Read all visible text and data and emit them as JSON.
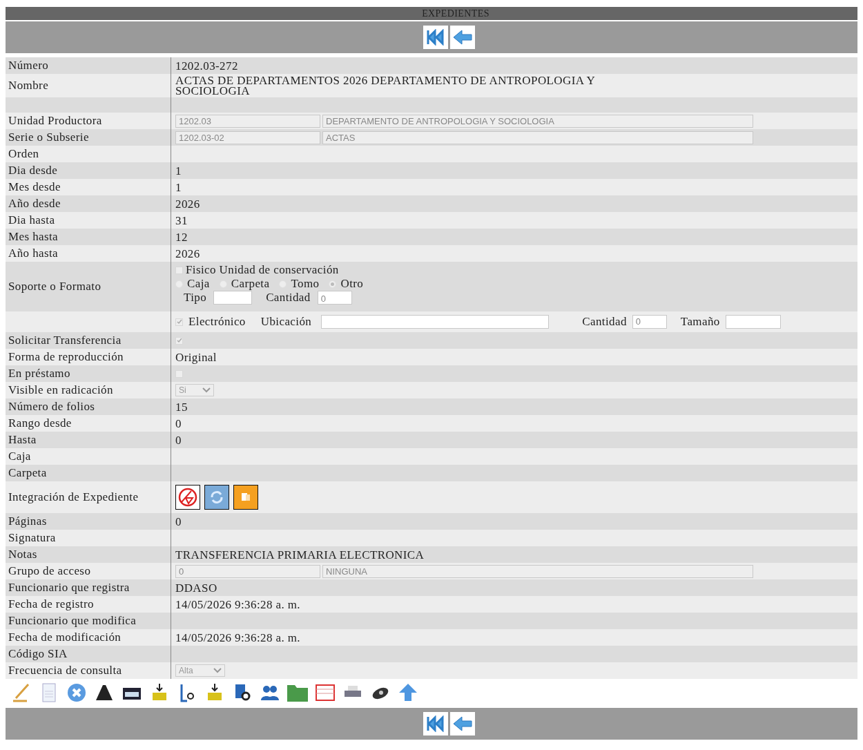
{
  "title": "EXPEDIENTES",
  "rows": [
    {
      "kind": "text",
      "label": "Número",
      "value": "1202.03-272"
    },
    {
      "kind": "text",
      "label": "Nombre",
      "value": "ACTAS DE DEPARTAMENTOS 2026 DEPARTAMENTO DE ANTROPOLOGIA Y SOCIOLOGIA"
    },
    {
      "kind": "blank"
    },
    {
      "kind": "fields",
      "label": "Unidad Productora",
      "code": "1202.03",
      "name": "DEPARTAMENTO DE ANTROPOLOGIA Y SOCIOLOGIA"
    },
    {
      "kind": "fields",
      "label": "Serie o Subserie",
      "code": "1202.03-02",
      "name": "ACTAS"
    },
    {
      "kind": "text",
      "label": "Orden"
    },
    {
      "kind": "text",
      "label": "Dia desde",
      "value": "1"
    },
    {
      "kind": "text",
      "label": "Mes desde",
      "value": "1"
    },
    {
      "kind": "text",
      "label": "Año desde",
      "value": "2026"
    },
    {
      "kind": "text",
      "label": "Dia hasta",
      "value": "31"
    },
    {
      "kind": "text",
      "label": "Mes hasta",
      "value": "12"
    },
    {
      "kind": "text",
      "label": "Año hasta",
      "value": "2026"
    },
    {
      "kind": "support",
      "label": "Soporte o Formato",
      "physical": {
        "label": "Fisico Unidad de conservación",
        "checked": false
      },
      "options": [
        {
          "label": "Caja",
          "selected": false
        },
        {
          "label": "Carpeta",
          "selected": false
        },
        {
          "label": "Tomo",
          "selected": false
        },
        {
          "label": "Otro",
          "selected": true
        }
      ],
      "type_label": "Tipo",
      "quantity_label": "Cantidad",
      "quantity": "0"
    },
    {
      "kind": "electronic",
      "checkbox": {
        "label": "Electrónico",
        "checked": true
      },
      "location_label": "Ubicación",
      "quantity_label": "Cantidad",
      "quantity": "0",
      "size_label": "Tamaño"
    },
    {
      "kind": "check",
      "label": "Solicitar Transferencia",
      "checked": true
    },
    {
      "kind": "text",
      "label": "Forma de reproducción",
      "value": "Original"
    },
    {
      "kind": "check",
      "label": "En préstamo",
      "checked": false
    },
    {
      "kind": "select",
      "label": "Visible en radicación",
      "value": "Si"
    },
    {
      "kind": "text",
      "label": "Número de folios",
      "value": "15"
    },
    {
      "kind": "text",
      "label": "Rango desde",
      "value": "0"
    },
    {
      "kind": "text",
      "label": "Hasta",
      "value": "0"
    },
    {
      "kind": "text",
      "label": "Caja"
    },
    {
      "kind": "text",
      "label": "Carpeta"
    },
    {
      "kind": "icons",
      "label": "Integración de Expediente"
    },
    {
      "kind": "text",
      "label": "Páginas",
      "value": "0"
    },
    {
      "kind": "text",
      "label": "Signatura"
    },
    {
      "kind": "text",
      "label": "Notas",
      "value": "TRANSFERENCIA PRIMARIA ELECTRONICA"
    },
    {
      "kind": "fields",
      "label": "Grupo de acceso",
      "code": "0",
      "name": "NINGUNA"
    },
    {
      "kind": "text",
      "label": "Funcionario que registra",
      "value": "DDASO"
    },
    {
      "kind": "text",
      "label": "Fecha de registro",
      "value": "14/05/2026 9:36:28 a. m."
    },
    {
      "kind": "text",
      "label": "Funcionario que modifica"
    },
    {
      "kind": "text",
      "label": "Fecha de modificación",
      "value": "14/05/2026 9:36:28 a. m."
    },
    {
      "kind": "text",
      "label": "Código SIA"
    },
    {
      "kind": "select",
      "label": "Frecuencia de consulta",
      "value": "Alta"
    }
  ]
}
